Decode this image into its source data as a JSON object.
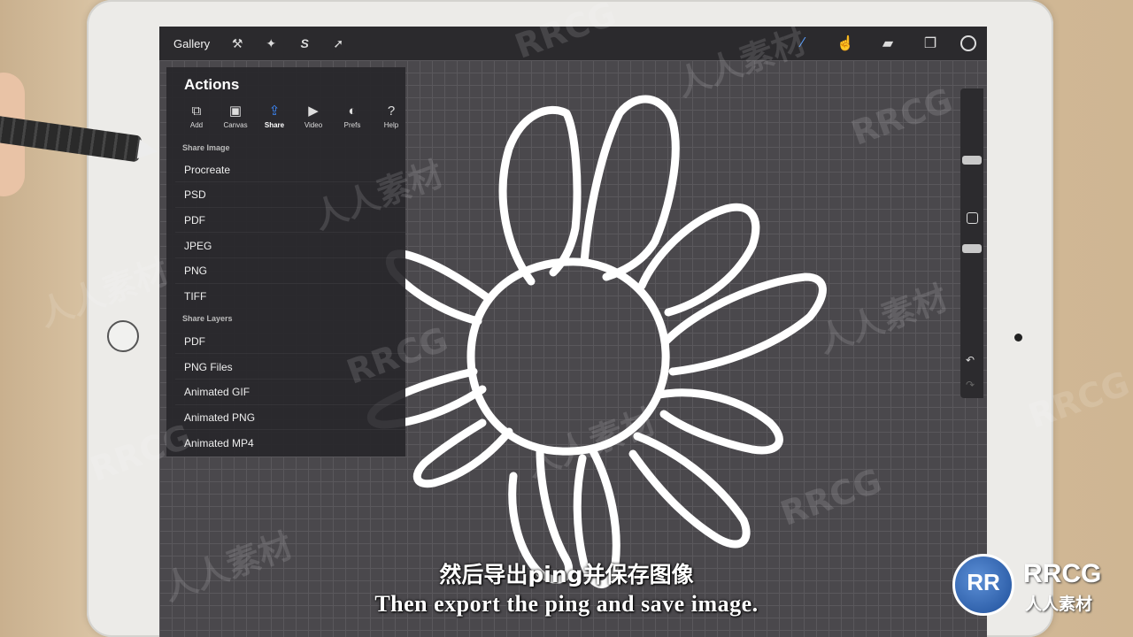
{
  "toolbar": {
    "gallery_label": "Gallery",
    "left_icons": [
      "wrench-icon",
      "magic-wand-icon",
      "selection-s-icon",
      "transform-arrow-icon"
    ],
    "right_icons": [
      "brush-icon",
      "smudge-icon",
      "eraser-icon",
      "layers-icon"
    ]
  },
  "actions": {
    "title": "Actions",
    "tabs": [
      {
        "label": "Add",
        "icon": "add-icon"
      },
      {
        "label": "Canvas",
        "icon": "canvas-icon"
      },
      {
        "label": "Share",
        "icon": "share-icon",
        "active": true
      },
      {
        "label": "Video",
        "icon": "video-icon"
      },
      {
        "label": "Prefs",
        "icon": "prefs-toggle-icon"
      },
      {
        "label": "Help",
        "icon": "help-icon"
      }
    ],
    "share_image_header": "Share Image",
    "share_image_items": [
      "Procreate",
      "PSD",
      "PDF",
      "JPEG",
      "PNG",
      "TIFF"
    ],
    "share_layers_header": "Share Layers",
    "share_layers_items": [
      "PDF",
      "PNG Files",
      "Animated GIF",
      "Animated PNG",
      "Animated MP4"
    ]
  },
  "subtitles": {
    "chinese": "然后导出ping并保存图像",
    "english": "Then export the ping and save image."
  },
  "watermark": {
    "text_latin": "RRCG",
    "text_cn": "人人素材"
  },
  "logo": {
    "mark": "RR",
    "name": "RRCG",
    "subtitle": "人人素材"
  }
}
